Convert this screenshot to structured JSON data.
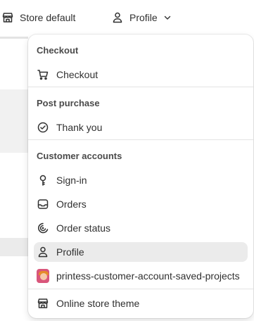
{
  "topbar": {
    "store_label": "Store default",
    "store_icon": "storefront-icon",
    "profile_label": "Profile",
    "profile_icon": "person-icon",
    "profile_chevron_icon": "chevron-down-icon"
  },
  "menu": {
    "sections": [
      {
        "title": "Checkout",
        "items": [
          {
            "label": "Checkout",
            "icon": "cart-icon"
          }
        ]
      },
      {
        "title": "Post purchase",
        "items": [
          {
            "label": "Thank you",
            "icon": "check-circle-icon"
          }
        ]
      },
      {
        "title": "Customer accounts",
        "items": [
          {
            "label": "Sign-in",
            "icon": "key-icon"
          },
          {
            "label": "Orders",
            "icon": "inbox-icon"
          },
          {
            "label": "Order status",
            "icon": "order-status-icon"
          },
          {
            "label": "Profile",
            "icon": "person-icon",
            "selected": true
          },
          {
            "label": "printess-customer-account-saved-projects",
            "icon": "app-avatar-icon"
          }
        ]
      }
    ],
    "footer_item": {
      "label": "Online store theme",
      "icon": "storefront-icon"
    }
  },
  "colors": {
    "text": "#303030",
    "section_title": "#4a4a4a",
    "selected_bg": "#ebebeb",
    "divider": "#e3e3e3",
    "avatar_bg": "#d9567b"
  }
}
